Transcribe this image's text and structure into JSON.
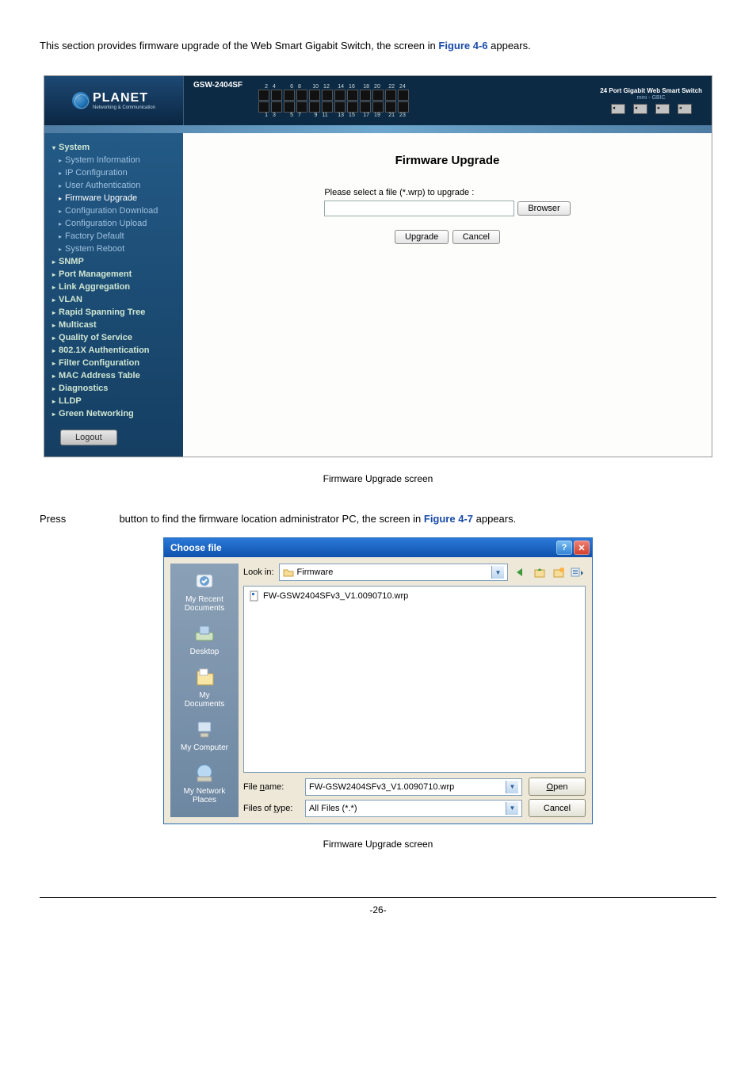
{
  "intro": {
    "text_before": "This section provides firmware upgrade of the Web Smart Gigabit Switch, the screen in ",
    "link": "Figure 4-6",
    "text_after": " appears."
  },
  "app": {
    "model": "GSW-2404SF",
    "logo_text": "PLANET",
    "logo_sub": "Networking & Communication",
    "gbic_title": "24 Port Gigabit Web Smart Switch",
    "gbic_sub": "mini - GBIC",
    "port_top_numbers": [
      "2",
      "4",
      "6",
      "8",
      "10",
      "12",
      "14",
      "16",
      "18",
      "20",
      "22",
      "24"
    ],
    "port_bottom_numbers": [
      "1",
      "3",
      "5",
      "7",
      "9",
      "11",
      "13",
      "15",
      "17",
      "19",
      "21",
      "23"
    ]
  },
  "sidebar": {
    "groups": [
      {
        "label": "System",
        "expandable": true,
        "children": [
          "System Information",
          "IP Configuration",
          "User Authentication",
          "Firmware Upgrade",
          "Configuration Download",
          "Configuration Upload",
          "Factory Default",
          "System Reboot"
        ]
      },
      {
        "label": "SNMP"
      },
      {
        "label": "Port Management"
      },
      {
        "label": "Link Aggregation"
      },
      {
        "label": "VLAN"
      },
      {
        "label": "Rapid Spanning Tree"
      },
      {
        "label": "Multicast"
      },
      {
        "label": "Quality of Service"
      },
      {
        "label": "802.1X Authentication"
      },
      {
        "label": "Filter Configuration"
      },
      {
        "label": "MAC Address Table"
      },
      {
        "label": "Diagnostics"
      },
      {
        "label": "LLDP"
      },
      {
        "label": "Green Networking"
      }
    ],
    "logout": "Logout"
  },
  "content": {
    "title": "Firmware Upgrade",
    "label": "Please select a file (*.wrp) to upgrade :",
    "browser_btn": "Browser",
    "upgrade_btn": "Upgrade",
    "cancel_btn": "Cancel"
  },
  "caption1": "Firmware Upgrade screen",
  "press": {
    "before": "Press ",
    "mid": " button to find the firmware location administrator PC, the screen in ",
    "link": "Figure 4-7",
    "after": " appears."
  },
  "dialog": {
    "title": "Choose file",
    "lookin_label": "Look in:",
    "lookin_value": "Firmware",
    "file": "FW-GSW2404SFv3_V1.0090710.wrp",
    "places": [
      "My Recent Documents",
      "Desktop",
      "My Documents",
      "My Computer",
      "My Network Places"
    ],
    "filename_label_pre": "File ",
    "filename_label_u": "n",
    "filename_label_post": "ame:",
    "filetype_label_pre": "Files of ",
    "filetype_label_u": "t",
    "filetype_label_post": "ype:",
    "filename_value": "FW-GSW2404SFv3_V1.0090710.wrp",
    "filetype_value": "All Files (*.*)",
    "open_u": "O",
    "open_rest": "pen",
    "cancel": "Cancel"
  },
  "caption2": "Firmware Upgrade screen",
  "footer": "-26-"
}
